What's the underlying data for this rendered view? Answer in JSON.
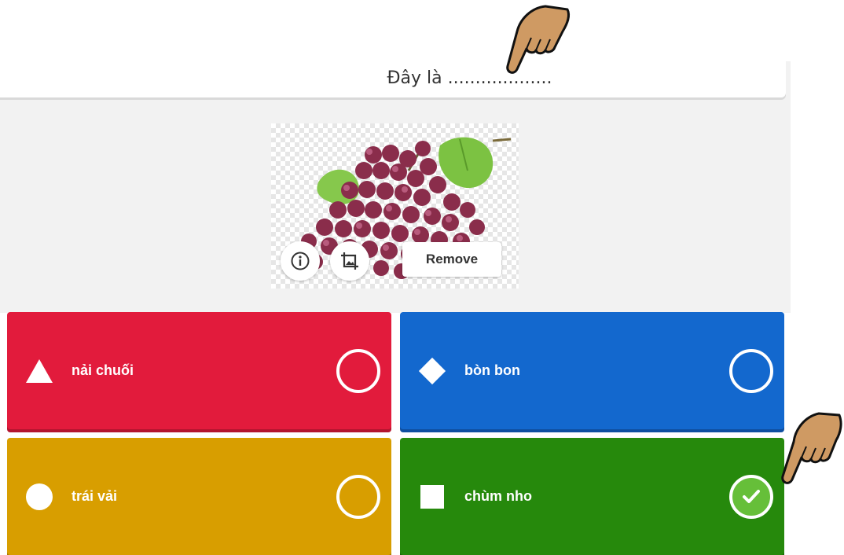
{
  "question": {
    "text": "Đây là ..................."
  },
  "media": {
    "image_subject": "grapes",
    "info_icon": "info-icon",
    "crop_icon": "crop-image-icon",
    "remove_label": "Remove"
  },
  "answers": [
    {
      "label": "nải chuối",
      "shape": "triangle",
      "color": "#e21b3c",
      "correct": false
    },
    {
      "label": "bòn bon",
      "shape": "diamond",
      "color": "#1368ce",
      "correct": false
    },
    {
      "label": "trái vải",
      "shape": "circle",
      "color": "#d89e00",
      "correct": false
    },
    {
      "label": "chùm nho",
      "shape": "square",
      "color": "#26890c",
      "correct": true
    }
  ],
  "annotations": {
    "pointer_icon": "pointing-hand-icon"
  }
}
